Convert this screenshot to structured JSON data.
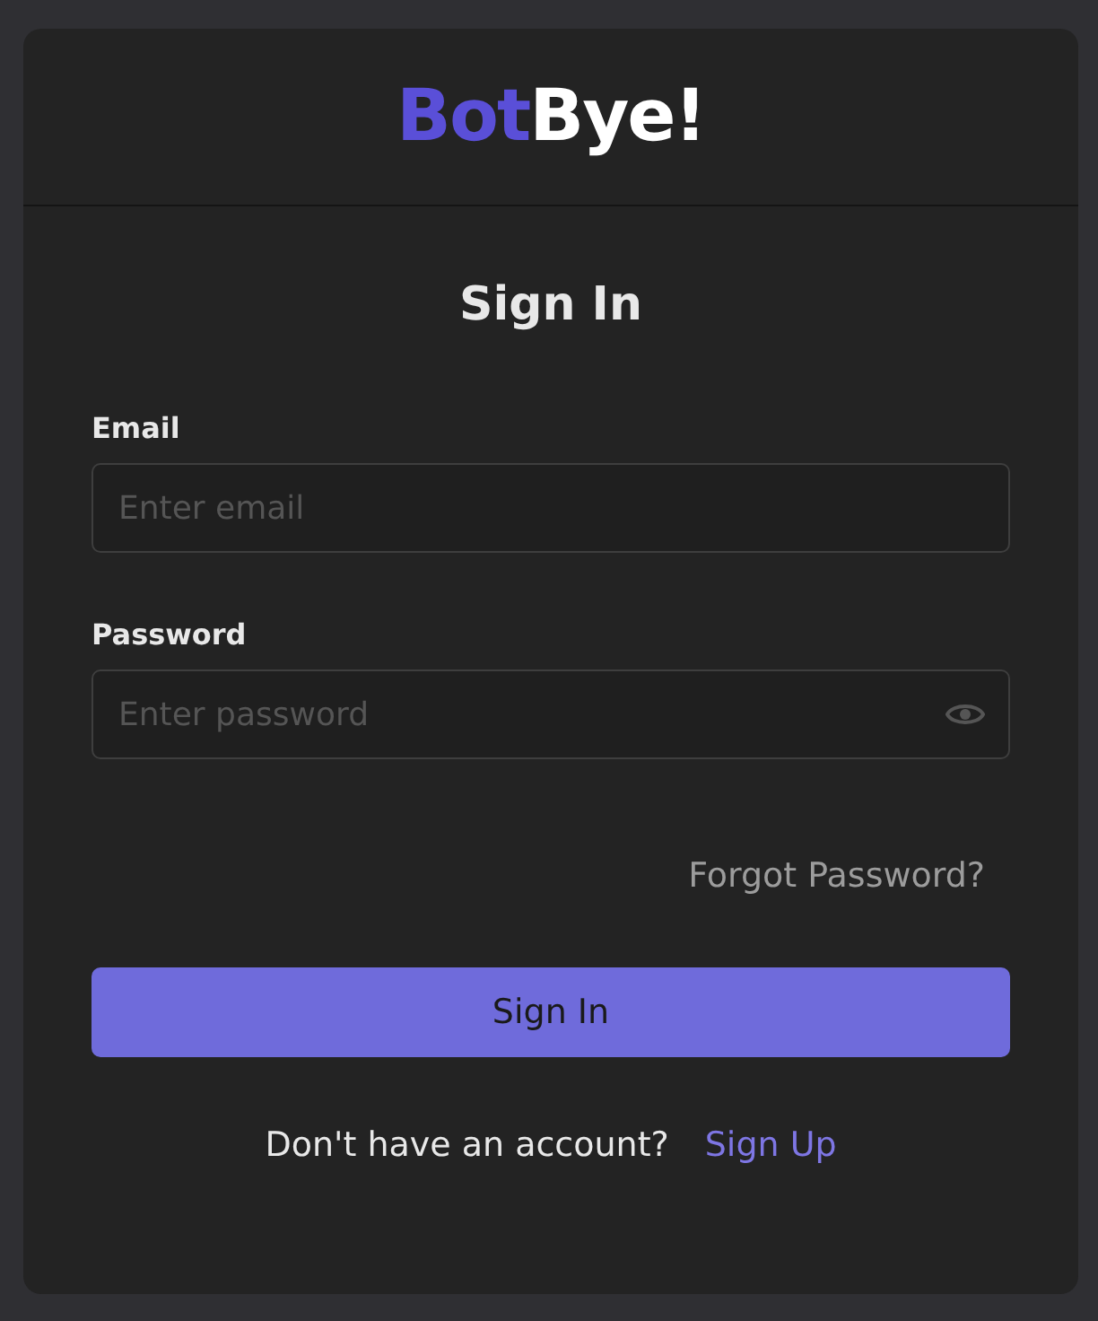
{
  "logo": {
    "parts": [
      {
        "text": "Bot",
        "color": "#5a4fd8"
      },
      {
        "text": "Bye!",
        "color": "#ffffff"
      }
    ]
  },
  "title": "Sign In",
  "fields": [
    {
      "label": "Email",
      "placeholder": "Enter email",
      "kind": "text"
    },
    {
      "label": "Password",
      "placeholder": "Enter password",
      "kind": "password"
    }
  ],
  "forgot_link": "Forgot Password?",
  "submit_button": "Sign In",
  "footer": {
    "text": "Don't have an account?",
    "link": "Sign Up"
  }
}
